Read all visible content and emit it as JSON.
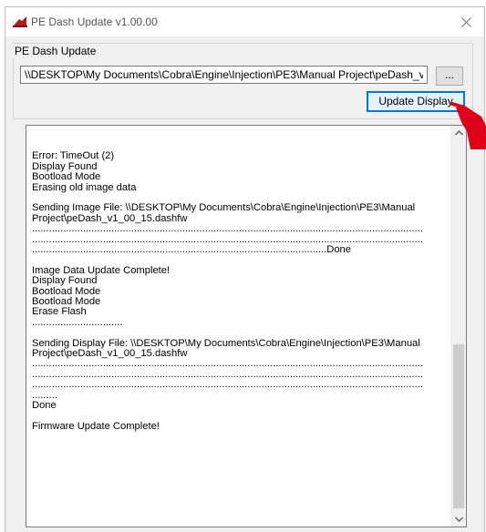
{
  "window": {
    "title": "PE Dash Update v1.00.00"
  },
  "group": {
    "legend": "PE Dash Update",
    "path_value": "\\\\DESKTOP\\My Documents\\Cobra\\Engine\\Injection\\PE3\\Manual Project\\peDash_v",
    "browse_label": "...",
    "update_label": "Update Display"
  },
  "log": {
    "lines": [
      "",
      "Error: TimeOut (2)",
      "Display Found",
      "Bootload Mode",
      "Erasing old image data",
      "",
      "Sending Image File: \\\\DESKTOP\\My Documents\\Cobra\\Engine\\Injection\\PE3\\Manual",
      "Project\\peDash_v1_00_15.dashfw",
      "..........................................................................................................................................",
      "..........................................................................................................................................",
      "........................................................................................................Done",
      "",
      "Image Data Update Complete!",
      "Display Found",
      "Bootload Mode",
      "Bootload Mode",
      "Erase Flash",
      "................................",
      "",
      "Sending Display File: \\\\DESKTOP\\My Documents\\Cobra\\Engine\\Injection\\PE3\\Manual",
      "Project\\peDash_v1_00_15.dashfw",
      "..........................................................................................................................................",
      "..........................................................................................................................................",
      "..........................................................................................................................................",
      ".........",
      "Done",
      "",
      "Firmware Update Complete!"
    ]
  },
  "colors": {
    "accent": "#0078d7",
    "app_icon": "#b71c1c",
    "cursor_hand": "#e0001a"
  }
}
